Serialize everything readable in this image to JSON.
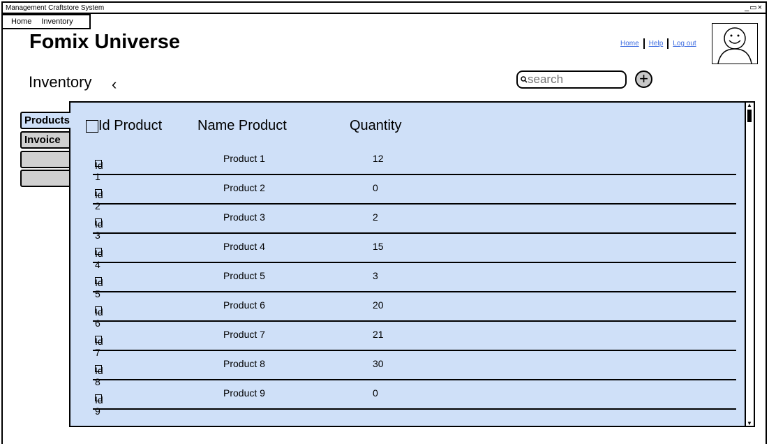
{
  "window": {
    "title": "Management Craftstore System",
    "controls": "_▭×"
  },
  "menu": [
    {
      "label": "Home"
    },
    {
      "label": "Inventory"
    }
  ],
  "brand": "Fomix Universe",
  "top_links": [
    {
      "label": "Home"
    },
    {
      "label": "Help"
    },
    {
      "label": "Log out"
    }
  ],
  "page_title": "Inventory",
  "back_glyph": "‹",
  "search": {
    "placeholder": "search"
  },
  "add_glyph": "+",
  "tabs": [
    {
      "label": "Products"
    },
    {
      "label": "Invoice"
    },
    {
      "label": ""
    },
    {
      "label": ""
    }
  ],
  "table": {
    "headers": [
      "Id Product",
      "Name Product",
      "Quantity"
    ],
    "rows": [
      {
        "id": "Id 1",
        "name": "Product 1",
        "qty": "12"
      },
      {
        "id": "Id 2",
        "name": "Product 2",
        "qty": "0"
      },
      {
        "id": "Id 3",
        "name": "Product 3",
        "qty": "2"
      },
      {
        "id": "Id 4",
        "name": "Product 4",
        "qty": "15"
      },
      {
        "id": "Id 5",
        "name": "Product 5",
        "qty": "3"
      },
      {
        "id": "Id 6",
        "name": "Product 6",
        "qty": "20"
      },
      {
        "id": "Id 7",
        "name": "Product 7",
        "qty": "21"
      },
      {
        "id": "Id 8",
        "name": "Product 8",
        "qty": "30"
      },
      {
        "id": "Id 9",
        "name": "Product 9",
        "qty": "0"
      }
    ]
  }
}
